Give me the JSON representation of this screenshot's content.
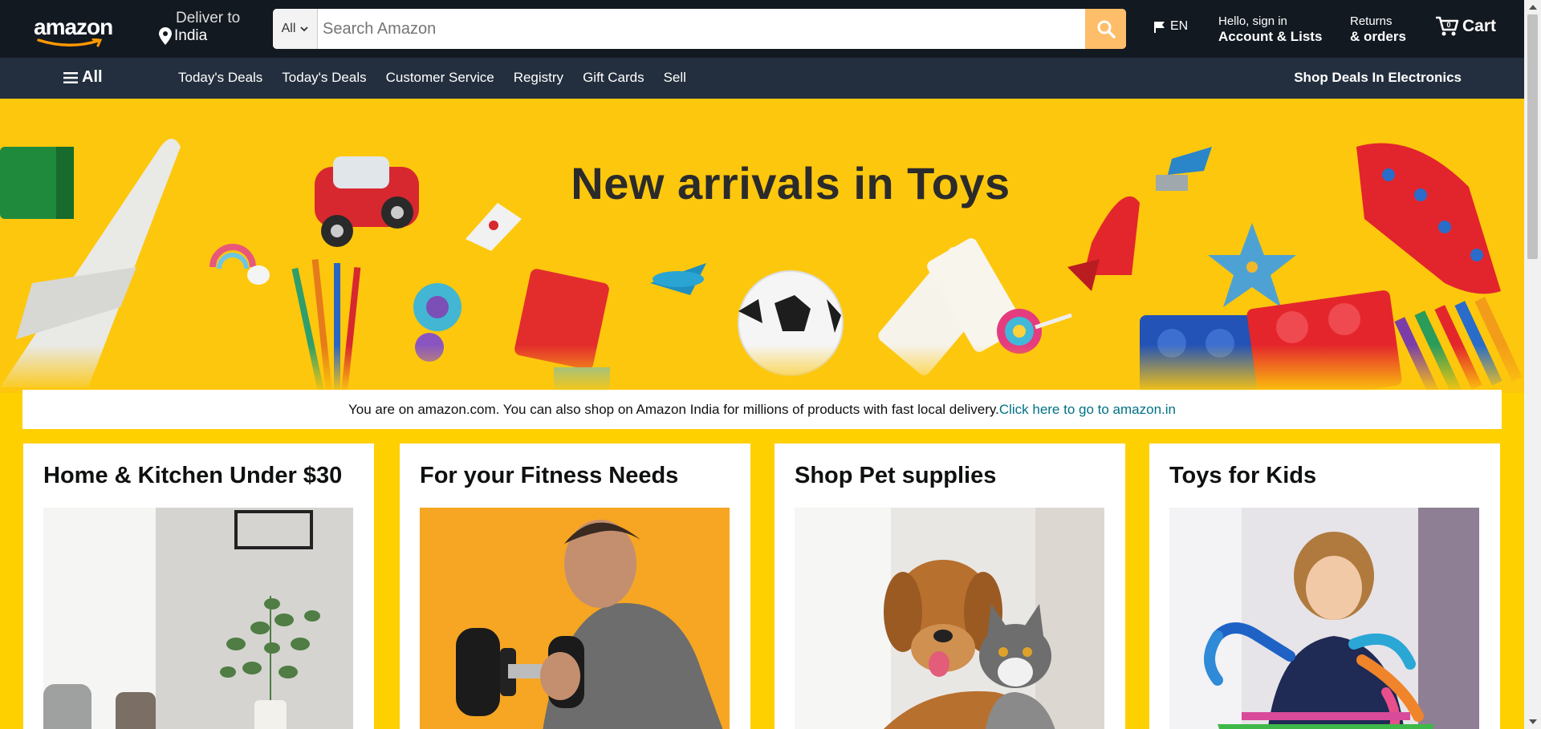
{
  "header": {
    "logo_text": "amazon",
    "deliver_label": "Deliver to",
    "deliver_location": "India",
    "search_category": "All",
    "search_placeholder": "Search Amazon",
    "language": "EN",
    "account_greeting": "Hello, sign in",
    "account_label": "Account & Lists",
    "returns_label": "Returns",
    "orders_label": "& orders",
    "cart_label": "Cart",
    "cart_count": "0"
  },
  "navbar": {
    "all_label": "All",
    "links": [
      "Today's Deals",
      "Today's Deals",
      "Customer Service",
      "Registry",
      "Gift Cards",
      "Sell"
    ],
    "right_label": "Shop Deals In Electronics"
  },
  "hero": {
    "title": "New arrivals in Toys"
  },
  "notice": {
    "text": "You are on amazon.com. You can also shop on Amazon India for millions of products with fast local delivery.",
    "link": "Click here to go to amazon.in"
  },
  "cards": [
    {
      "title": "Home & Kitchen Under $30"
    },
    {
      "title": "For your Fitness Needs"
    },
    {
      "title": "Shop Pet supplies"
    },
    {
      "title": "Toys for Kids"
    }
  ],
  "colors": {
    "header_bg": "#131921",
    "nav_bg": "#232f3e",
    "search_button": "#febd69",
    "page_bg": "#ffd000",
    "link": "#007185"
  },
  "icons": {
    "location": "location-pin-icon",
    "search": "search-icon",
    "flag": "flag-icon",
    "cart": "cart-icon",
    "menu": "hamburger-menu-icon"
  }
}
